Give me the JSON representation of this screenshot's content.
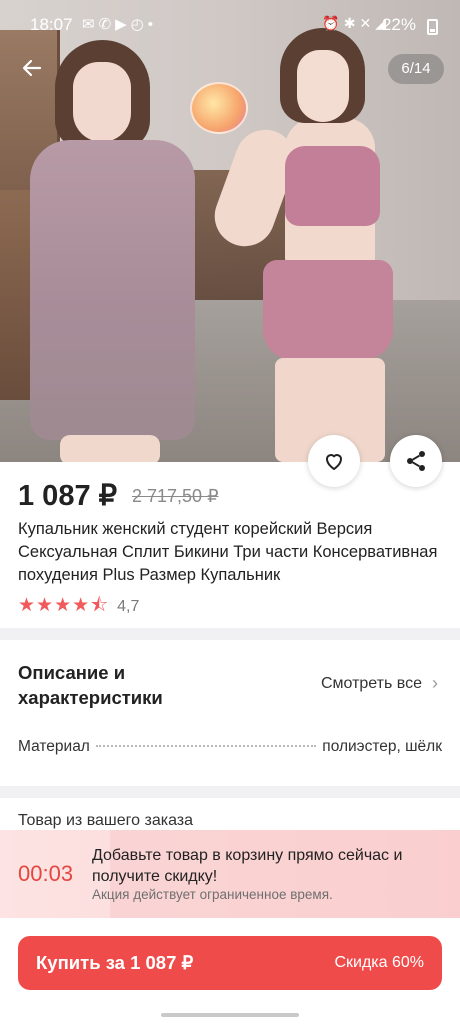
{
  "status_bar": {
    "time": "18:07",
    "battery": "22%"
  },
  "gallery": {
    "counter": "6/14"
  },
  "product": {
    "price": "1 087 ₽",
    "old_price": "2 717,50 ₽",
    "title": "Купальник женский студент корейский Версия Сексуальная Сплит Бикини Три части Консервативная похудения Plus Размер Купальник",
    "rating": "4,7",
    "rating_stars": 4.7
  },
  "description": {
    "title": "Описание и характеристики",
    "see_all": "Смотреть все",
    "attributes": [
      {
        "name": "Материал",
        "value": "полиэстер, шёлк"
      }
    ]
  },
  "order_section": {
    "label": "Товар из вашего заказа"
  },
  "promo": {
    "timer": "00:03",
    "text": "Добавьте товар в корзину прямо сейчас и получите скидку!",
    "subtext": "Акция действует ограниченное время."
  },
  "buy_button": {
    "label": "Купить за 1 087 ₽",
    "discount": "Скидка 60%"
  },
  "colors": {
    "accent": "#ef4b4b",
    "timer": "#e4473f",
    "promo_bg": "#fde3e3"
  }
}
